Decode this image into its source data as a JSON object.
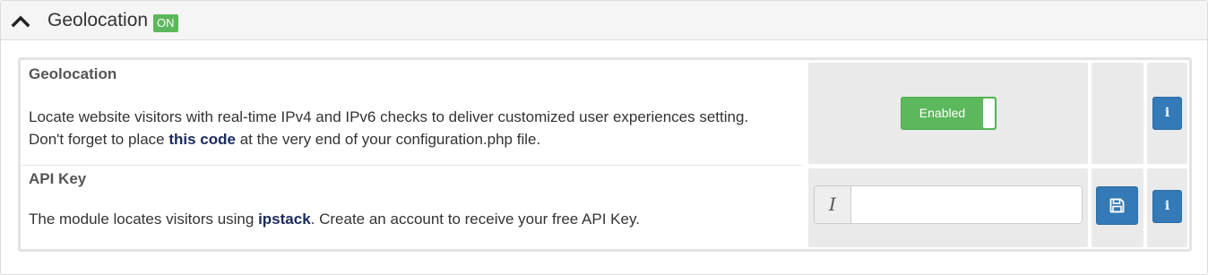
{
  "header": {
    "title": "Geolocation",
    "badge": "ON"
  },
  "settings": [
    {
      "title": "Geolocation",
      "text_line1": "Locate website visitors with real-time IPv4 and IPv6 checks to deliver customized user experiences setting.",
      "text_line2_before": "Don't forget to place ",
      "text_line2_link": "this code",
      "text_line2_after": " at the very end of your configuration.php file.",
      "toggle_label": "Enabled",
      "toggle_state": "on",
      "info_icon": "info-icon"
    },
    {
      "title": "API Key",
      "text_before": "The module locates visitors using ",
      "text_link": "ipstack",
      "text_after": ". Create an account to receive your free API Key.",
      "input_addon": "I",
      "input_value": "",
      "save_icon": "save-icon",
      "info_icon": "info-icon"
    }
  ],
  "colors": {
    "accent_blue": "#337ab7",
    "success_green": "#5cb85c",
    "link_navy": "#1a2a5a"
  }
}
